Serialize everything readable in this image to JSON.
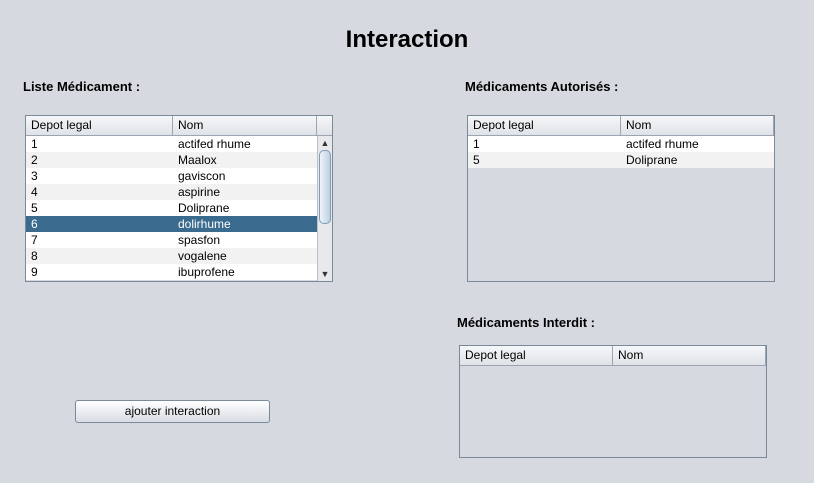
{
  "window": {
    "title": "Interaction"
  },
  "liste": {
    "label": "Liste Médicament :",
    "columns": [
      "Depot legal",
      "Nom"
    ],
    "rows": [
      {
        "depot": "1",
        "nom": "actifed rhume"
      },
      {
        "depot": "2",
        "nom": "Maalox"
      },
      {
        "depot": "3",
        "nom": "gaviscon"
      },
      {
        "depot": "4",
        "nom": "aspirine"
      },
      {
        "depot": "5",
        "nom": "Doliprane"
      },
      {
        "depot": "6",
        "nom": "dolirhume"
      },
      {
        "depot": "7",
        "nom": "spasfon"
      },
      {
        "depot": "8",
        "nom": "vogalene"
      },
      {
        "depot": "9",
        "nom": "ibuprofene"
      }
    ],
    "selected_depot": "6",
    "scroll_up_icon": "arrow-up-icon",
    "scroll_down_icon": "arrow-down-icon"
  },
  "autorises": {
    "label": "Médicaments Autorisés :",
    "columns": [
      "Depot legal",
      "Nom"
    ],
    "rows": [
      {
        "depot": "1",
        "nom": "actifed rhume"
      },
      {
        "depot": "5",
        "nom": "Doliprane"
      }
    ]
  },
  "interdits": {
    "label": "Médicaments Interdit :",
    "columns": [
      "Depot legal",
      "Nom"
    ],
    "rows": []
  },
  "actions": {
    "ajouter_label": "ajouter interaction"
  },
  "colors": {
    "background": "#d6d9df",
    "selection": "#3a6a8e",
    "row_odd": "#f2f2f2",
    "row_even": "#ffffff"
  }
}
